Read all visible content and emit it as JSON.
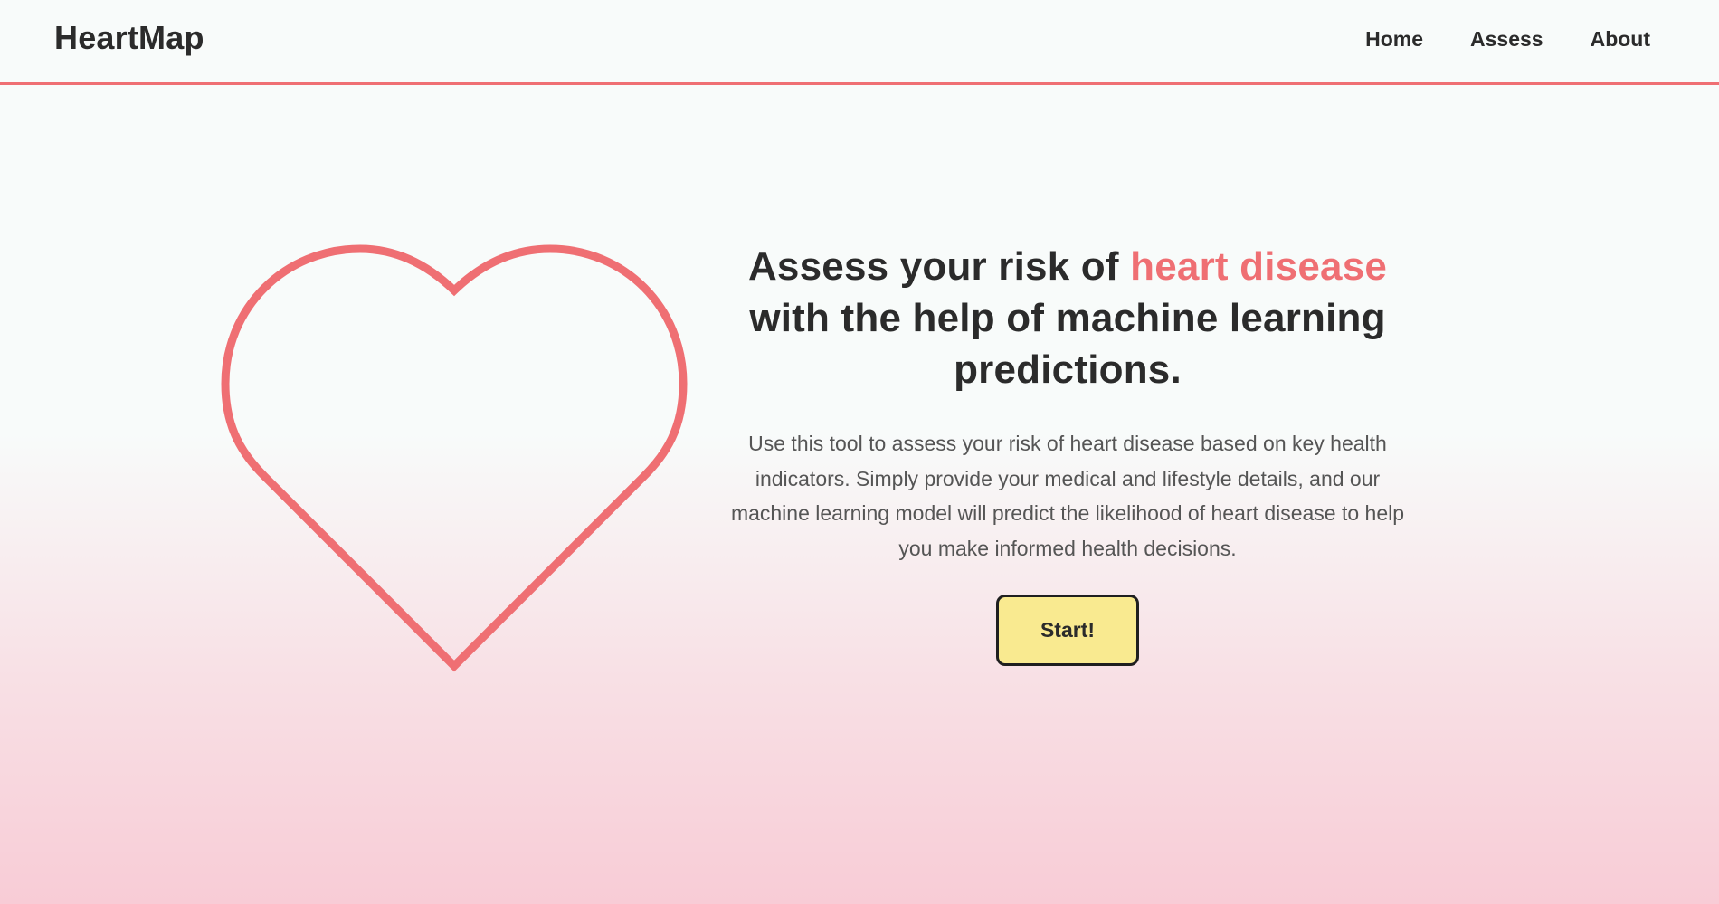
{
  "brand": {
    "name": "HeartMap"
  },
  "nav": {
    "items": [
      {
        "label": "Home"
      },
      {
        "label": "Assess"
      },
      {
        "label": "About"
      }
    ]
  },
  "hero": {
    "headline_pre": "Assess your risk of ",
    "headline_highlight": "heart disease",
    "headline_post": " with the help of machine learning predictions.",
    "description": "Use this tool to assess your risk of heart disease based on key health indicators. Simply provide your medical and lifestyle details, and our machine learning model will predict the likelihood of heart disease to help you make informed health decisions.",
    "start_label": "Start!",
    "illustration_icon": "heart-outline-icon"
  },
  "colors": {
    "accent": "#ef6f73",
    "text": "#2b2b2b",
    "button_bg": "#f9ea90",
    "button_border": "#1f1f1f",
    "bg_top": "#f8fbfa",
    "bg_bottom": "#f8ccd6"
  }
}
